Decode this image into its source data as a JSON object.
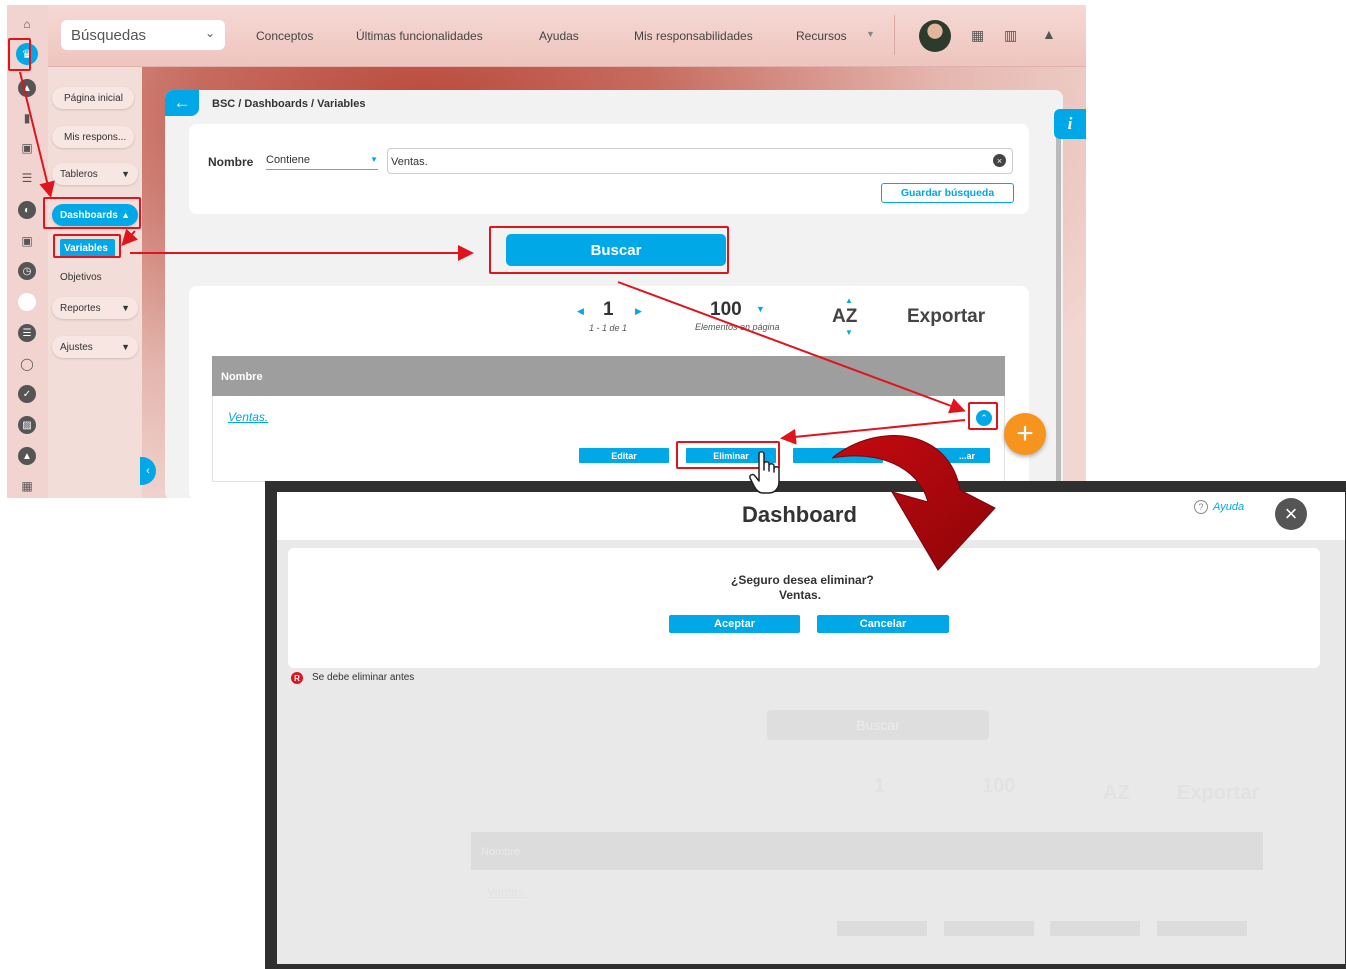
{
  "topbar": {
    "search_select": "Búsquedas",
    "nav": [
      "Conceptos",
      "Últimas funcionalidades",
      "Ayudas",
      "Mis responsabilidades",
      "Recursos"
    ]
  },
  "sidebar": {
    "items": [
      {
        "label": "Página inicial"
      },
      {
        "label": "Mis respons..."
      },
      {
        "label": "Tableros"
      },
      {
        "label": "Dashboards"
      },
      {
        "label": "Variables"
      },
      {
        "label": "Objetivos"
      },
      {
        "label": "Reportes"
      },
      {
        "label": "Ajustes"
      }
    ]
  },
  "breadcrumb": "BSC / Dashboards / Variables",
  "filter": {
    "field_label": "Nombre",
    "operator": "Contiene",
    "value": "Ventas.",
    "save_search": "Guardar búsqueda"
  },
  "search_button": "Buscar",
  "pager": {
    "page": "1",
    "range": "1 - 1 de 1",
    "per_page": "100",
    "per_page_label": "Elementos en página",
    "sort": "AZ",
    "export": "Exportar"
  },
  "table": {
    "header": "Nombre",
    "row_name": "Ventas.",
    "actions": [
      "Editar",
      "Eliminar",
      "",
      "...ar"
    ]
  },
  "dialog": {
    "title": "Dashboard",
    "help": "Ayuda",
    "question": "¿Seguro desea eliminar?",
    "item": "Ventas.",
    "accept": "Aceptar",
    "cancel": "Cancelar",
    "note": "Se debe eliminar antes"
  },
  "background_ghost": {
    "search": "Buscar",
    "page": "1",
    "per_page": "100",
    "sort": "AZ",
    "export": "Exportar",
    "row": "Ventas.",
    "header": "Nombre"
  },
  "colors": {
    "accent": "#00a8e8",
    "highlight": "#e0141c",
    "fab": "#f7941d"
  }
}
